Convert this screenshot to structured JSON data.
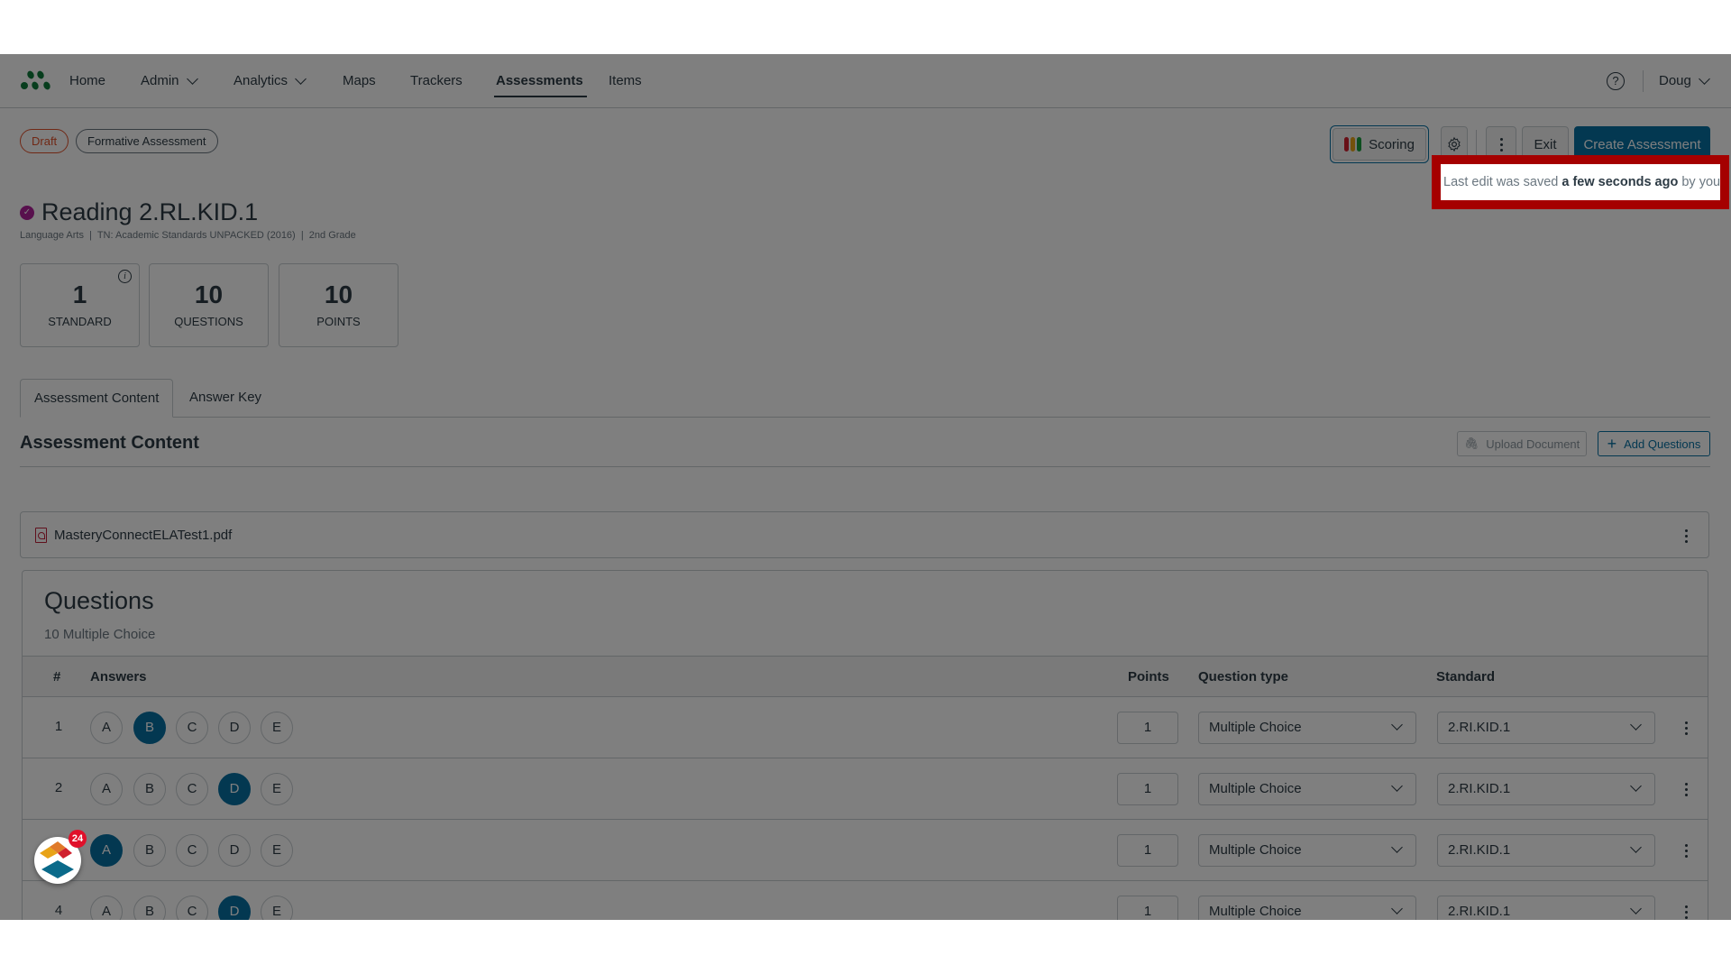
{
  "nav": {
    "items": [
      {
        "label": "Home",
        "dropdown": false,
        "active": false
      },
      {
        "label": "Admin",
        "dropdown": true,
        "active": false
      },
      {
        "label": "Analytics",
        "dropdown": true,
        "active": false
      },
      {
        "label": "Maps",
        "dropdown": false,
        "active": false
      },
      {
        "label": "Trackers",
        "dropdown": false,
        "active": false
      },
      {
        "label": "Assessments",
        "dropdown": false,
        "active": true
      },
      {
        "label": "Items",
        "dropdown": false,
        "active": false
      }
    ],
    "help_icon": "question-circle-icon",
    "user": "Doug"
  },
  "badges": {
    "status": "Draft",
    "type": "Formative Assessment"
  },
  "actions": {
    "scoring": "Scoring",
    "settings_icon": "gear-icon",
    "more_icon": "kebab-icon",
    "exit": "Exit",
    "create": "Create Assessment"
  },
  "save_status": {
    "prefix": "Last edit was saved",
    "emphasis": "a few seconds ago",
    "suffix": "by you"
  },
  "assessment": {
    "title": "Reading 2.RL.KID.1",
    "meta": "Language Arts  |  TN: Academic Standards UNPACKED (2016)  |  2nd Grade"
  },
  "stats": [
    {
      "value": "1",
      "label": "STANDARD",
      "info": true
    },
    {
      "value": "10",
      "label": "QUESTIONS",
      "info": false
    },
    {
      "value": "10",
      "label": "POINTS",
      "info": false
    }
  ],
  "tabs": [
    {
      "label": "Assessment Content",
      "active": true
    },
    {
      "label": "Answer Key",
      "active": false
    }
  ],
  "content": {
    "title": "Assessment Content",
    "upload_label": "Upload Document",
    "add_label": "Add Questions",
    "file_name": "MasteryConnectELATest1.pdf"
  },
  "questions": {
    "title": "Questions",
    "summary": "10 Multiple Choice",
    "columns": {
      "num": "#",
      "answers": "Answers",
      "points": "Points",
      "type": "Question type",
      "standard": "Standard"
    },
    "choices": [
      "A",
      "B",
      "C",
      "D",
      "E"
    ],
    "rows": [
      {
        "num": "1",
        "selected": "B",
        "points": "1",
        "type": "Multiple Choice",
        "standard": "2.RI.KID.1"
      },
      {
        "num": "2",
        "selected": "D",
        "points": "1",
        "type": "Multiple Choice",
        "standard": "2.RI.KID.1"
      },
      {
        "num": "",
        "selected": "A",
        "points": "1",
        "type": "Multiple Choice",
        "standard": "2.RI.KID.1"
      },
      {
        "num": "4",
        "selected": "D",
        "points": "1",
        "type": "Multiple Choice",
        "standard": "2.RI.KID.1"
      }
    ]
  },
  "widget": {
    "badge_count": "24"
  },
  "colors": {
    "accent": "#0770a3",
    "draft": "#e0502a",
    "highlight": "#a50000",
    "verified": "#b0219b"
  }
}
